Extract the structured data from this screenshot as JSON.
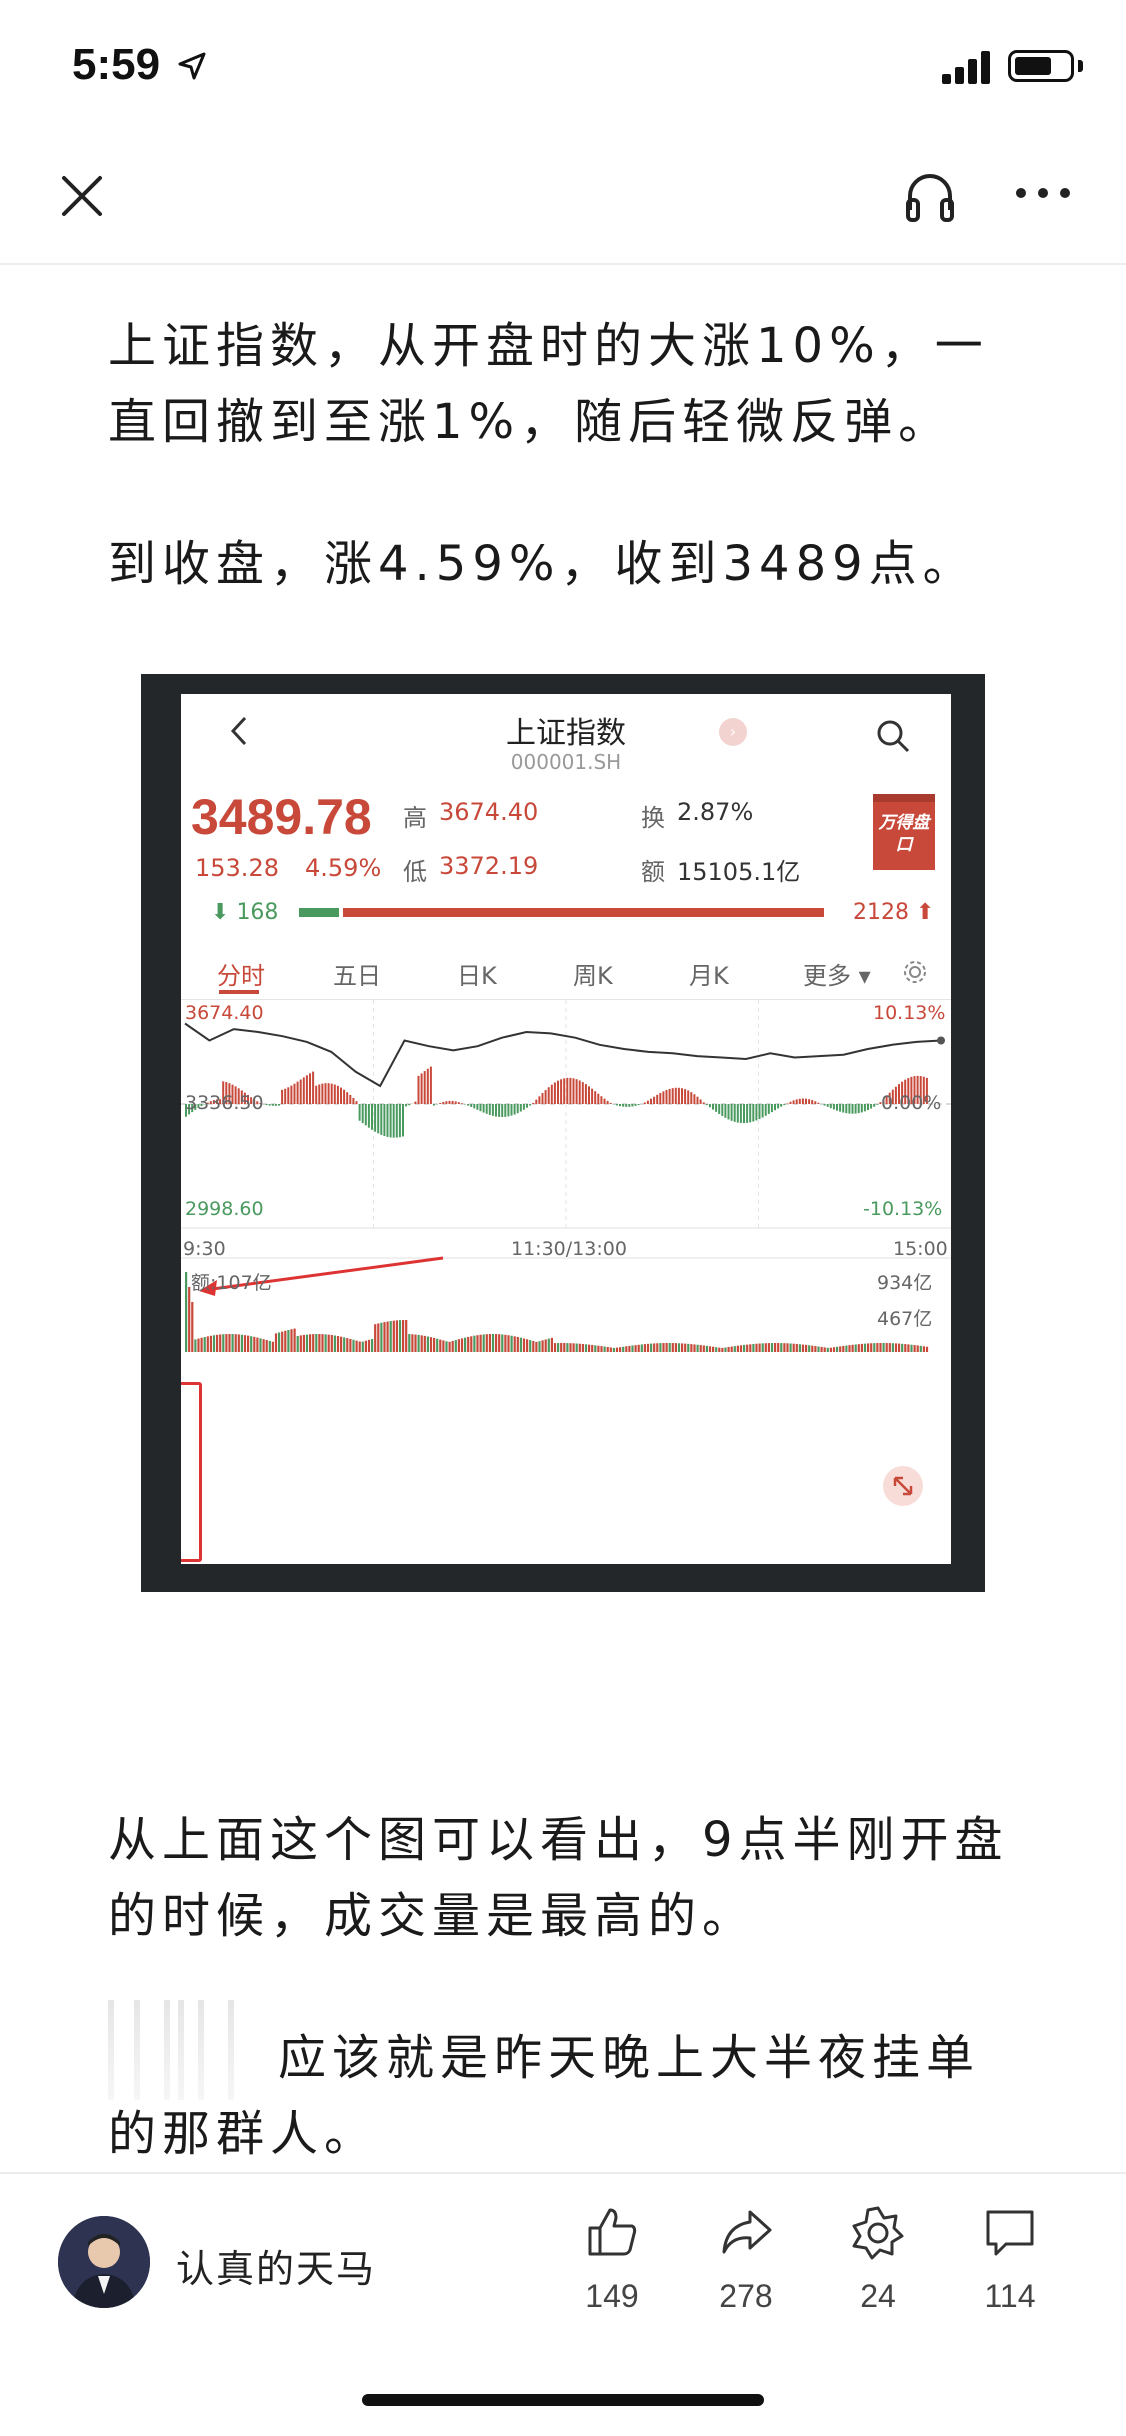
{
  "status_bar": {
    "time": "5:59"
  },
  "article": {
    "paragraphs": [
      "上证指数，从开盘时的大涨10%，一直回撤到至涨1%，随后轻微反弹。",
      "到收盘，涨4.59%，收到3489点。",
      "从上面这个图可以看出，9点半刚开盘的时候，成交量是最高的。",
      "应该就是昨天晚上大半夜挂单的那群人。"
    ]
  },
  "chart_image": {
    "title": "上证指数",
    "code": "000001.SH",
    "price": "3489.78",
    "change": "153.28",
    "change_pct": "4.59%",
    "high_label": "高",
    "high": "3674.40",
    "low_label": "低",
    "low": "3372.19",
    "turnover_label": "换",
    "turnover": "2.87%",
    "amount_label": "额",
    "amount": "15105.1亿",
    "badge": "万得盘口",
    "decliners": "168",
    "advancers": "2128",
    "tabs": [
      "分时",
      "五日",
      "日K",
      "周K",
      "月K",
      "更多"
    ],
    "active_tab": "分时",
    "y_top": "3674.40",
    "y_mid": "3336.50",
    "y_bottom": "2998.60",
    "pct_top": "10.13%",
    "pct_mid": "0.00%",
    "pct_bottom": "-10.13%",
    "time_start": "9:30",
    "time_mid": "11:30/13:00",
    "time_end": "15:00",
    "volume_label": "额:107亿",
    "vol_max": "934亿",
    "vol_mid": "467亿"
  },
  "chart_data": {
    "type": "line",
    "title": "上证指数",
    "x": [
      "9:30",
      "11:30/13:00",
      "15:00"
    ],
    "price_series": [
      3620,
      3560,
      3600,
      3590,
      3575,
      3555,
      3520,
      3450,
      3400,
      3560,
      3540,
      3525,
      3540,
      3570,
      3590,
      3585,
      3570,
      3545,
      3530,
      3520,
      3515,
      3505,
      3500,
      3495,
      3515,
      3500,
      3505,
      3510,
      3530,
      3545,
      3555,
      3560
    ],
    "ylim": [
      2998.6,
      3674.4
    ],
    "pct_range": [
      "-10.13%",
      "10.13%"
    ],
    "volume_ylim_yi": [
      0,
      934
    ]
  },
  "author": {
    "name": "认真的天马"
  },
  "actions": [
    {
      "icon": "thumbs-up-icon",
      "count": "149"
    },
    {
      "icon": "share-icon",
      "count": "278"
    },
    {
      "icon": "recommend-icon",
      "count": "24"
    },
    {
      "icon": "comment-icon",
      "count": "114"
    }
  ]
}
